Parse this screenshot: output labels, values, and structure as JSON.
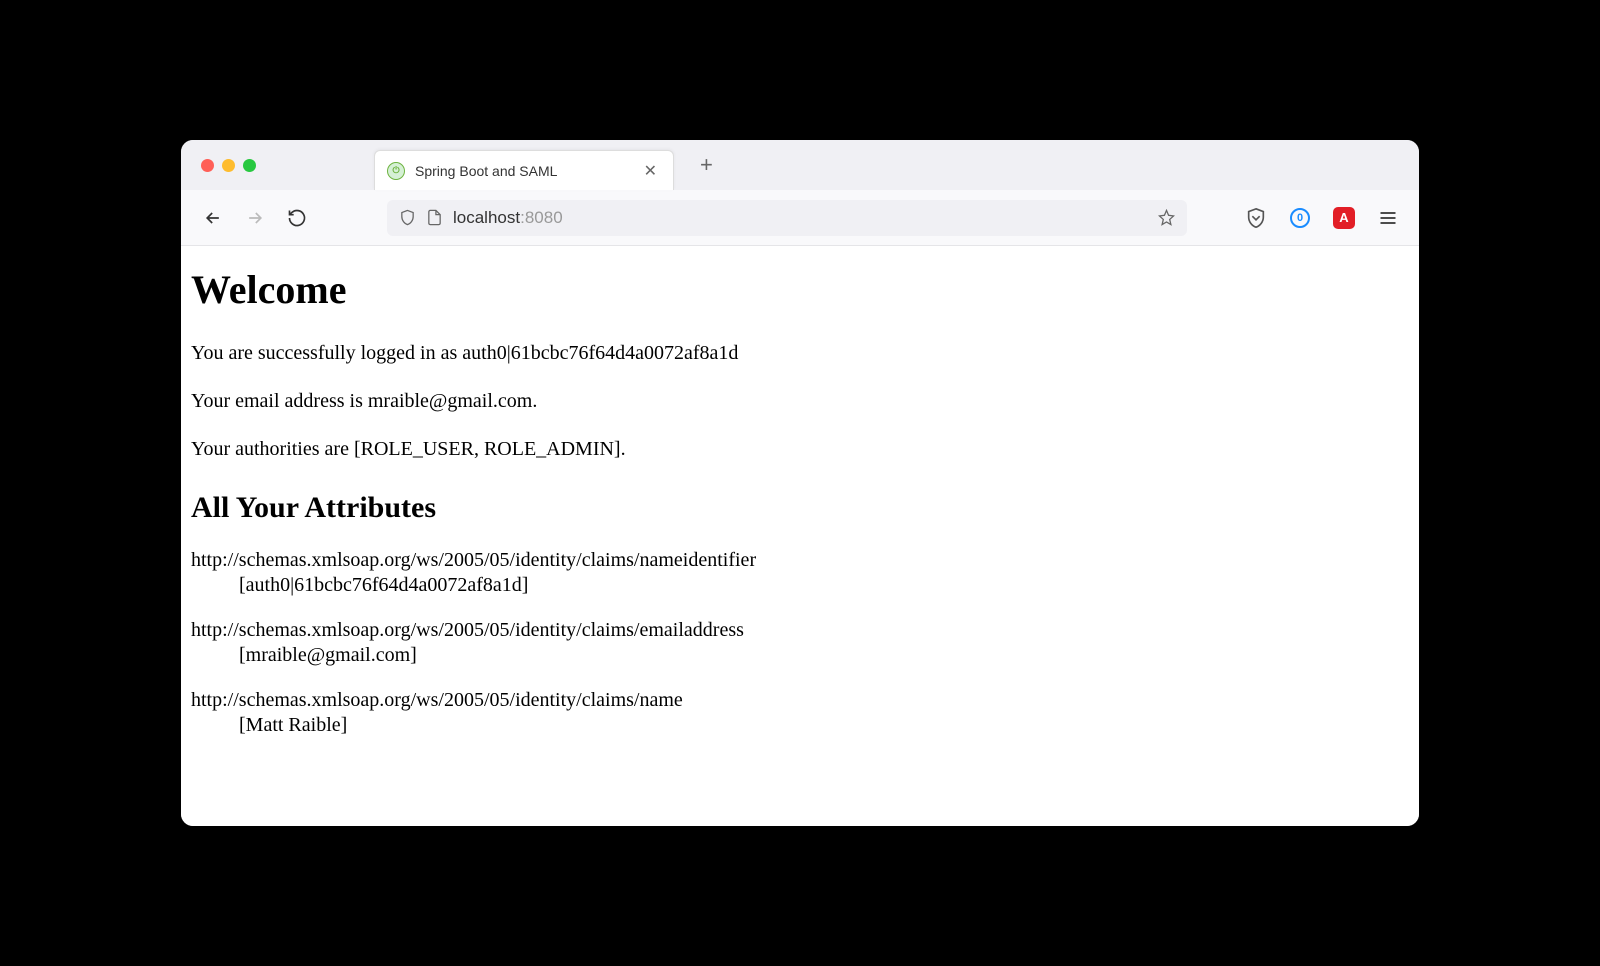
{
  "browser": {
    "tab": {
      "title": "Spring Boot and SAML",
      "favicon_letter": "⏻"
    },
    "url": {
      "host": "localhost",
      "port": ":8080"
    },
    "extensions": {
      "onepassword_label": "0",
      "adblock_label": "A"
    }
  },
  "page": {
    "heading": "Welcome",
    "login_message": "You are successfully logged in as auth0|61bcbc76f64d4a0072af8a1d",
    "email_message": "Your email address is mraible@gmail.com.",
    "authorities_message": "Your authorities are [ROLE_USER, ROLE_ADMIN].",
    "attributes_heading": "All Your Attributes",
    "attributes": [
      {
        "key": "http://schemas.xmlsoap.org/ws/2005/05/identity/claims/nameidentifier",
        "value": "[auth0|61bcbc76f64d4a0072af8a1d]"
      },
      {
        "key": "http://schemas.xmlsoap.org/ws/2005/05/identity/claims/emailaddress",
        "value": "[mraible@gmail.com]"
      },
      {
        "key": "http://schemas.xmlsoap.org/ws/2005/05/identity/claims/name",
        "value": "[Matt Raible]"
      }
    ]
  }
}
